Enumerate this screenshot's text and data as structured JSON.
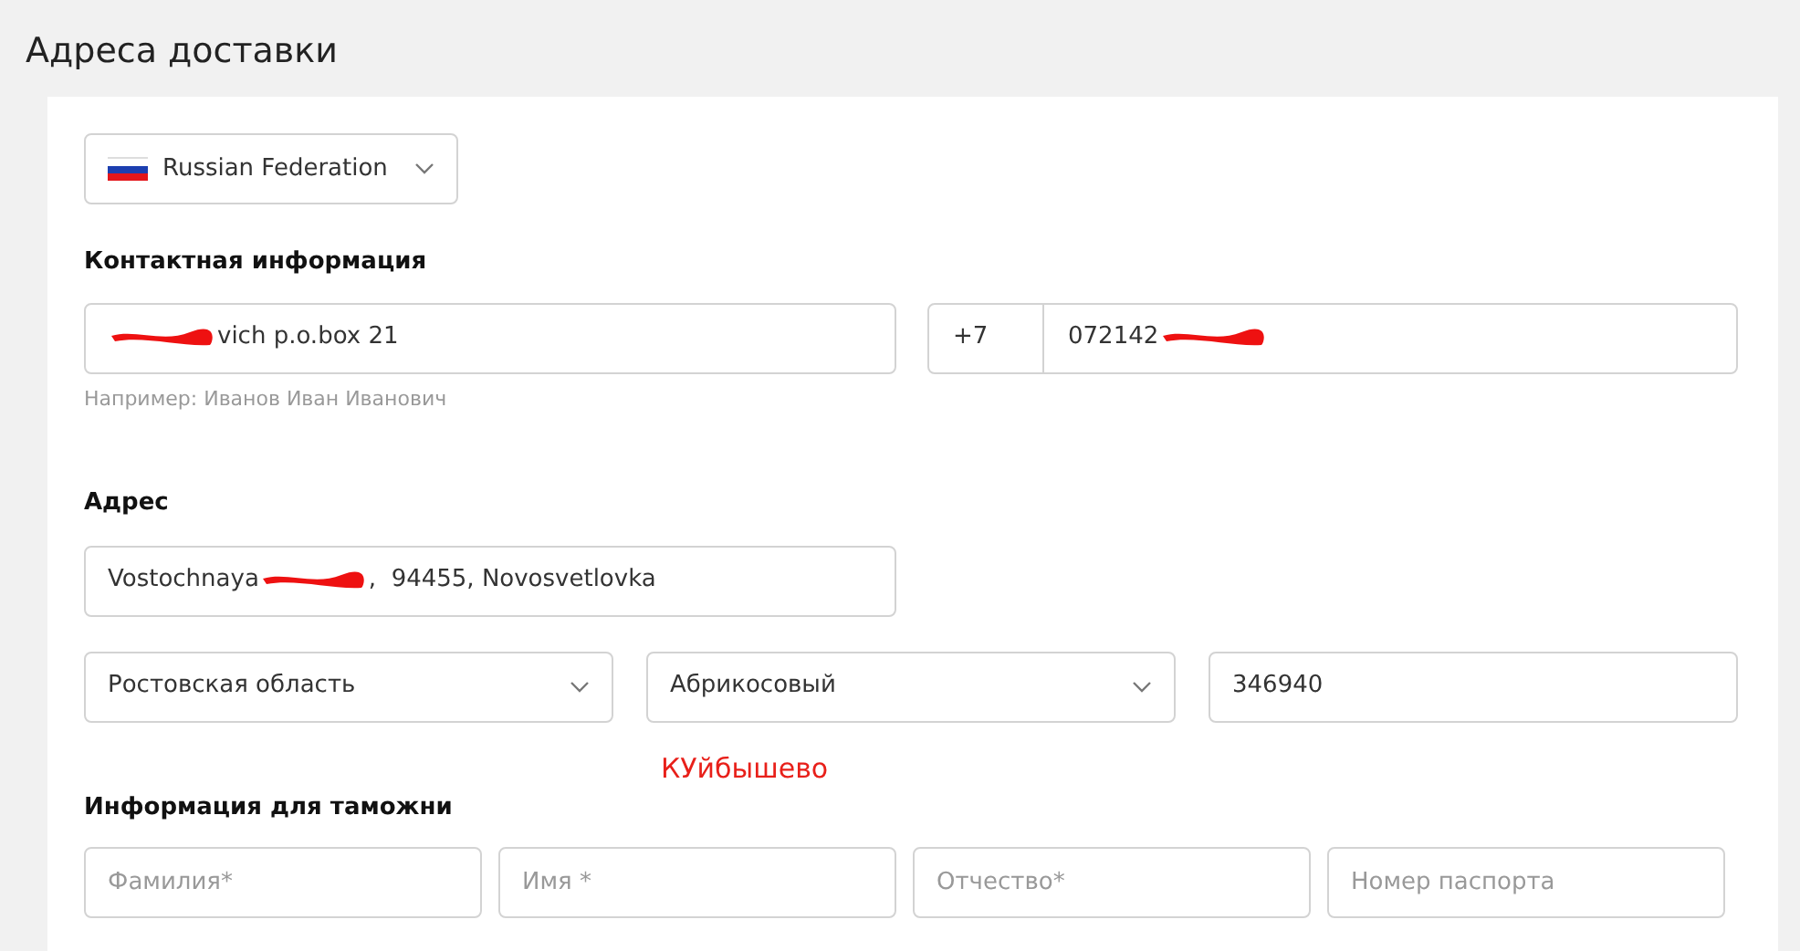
{
  "page_title": "Адреса доставки",
  "country": {
    "label": "Russian Federation"
  },
  "contact": {
    "heading": "Контактная информация",
    "name_field": {
      "segments": [
        {
          "kind": "redaction"
        },
        {
          "kind": "text",
          "text": "vich p.o.box 21"
        }
      ],
      "hint": "Например: Иванов Иван Иванович"
    },
    "phone": {
      "code": "+7",
      "segments": [
        {
          "kind": "text",
          "text": "072142"
        },
        {
          "kind": "redaction"
        }
      ]
    }
  },
  "address": {
    "heading": "Адрес",
    "street": {
      "segments": [
        {
          "kind": "text",
          "text": "Vostochnaya"
        },
        {
          "kind": "redaction"
        },
        {
          "kind": "text",
          "text": ",  94455, Novosvetlovka"
        }
      ]
    },
    "fields": [
      {
        "kind": "select",
        "value": "Ростовская область"
      },
      {
        "kind": "select",
        "value": "Абрикосовый"
      },
      {
        "kind": "input",
        "value": "346940"
      }
    ],
    "annotation": "КУйбышево"
  },
  "customs": {
    "heading": "Информация для таможни",
    "fields": [
      {
        "placeholder": "Фамилия*"
      },
      {
        "placeholder": "Имя *"
      },
      {
        "placeholder": "Отчество*"
      },
      {
        "placeholder": "Номер паспорта"
      }
    ]
  }
}
